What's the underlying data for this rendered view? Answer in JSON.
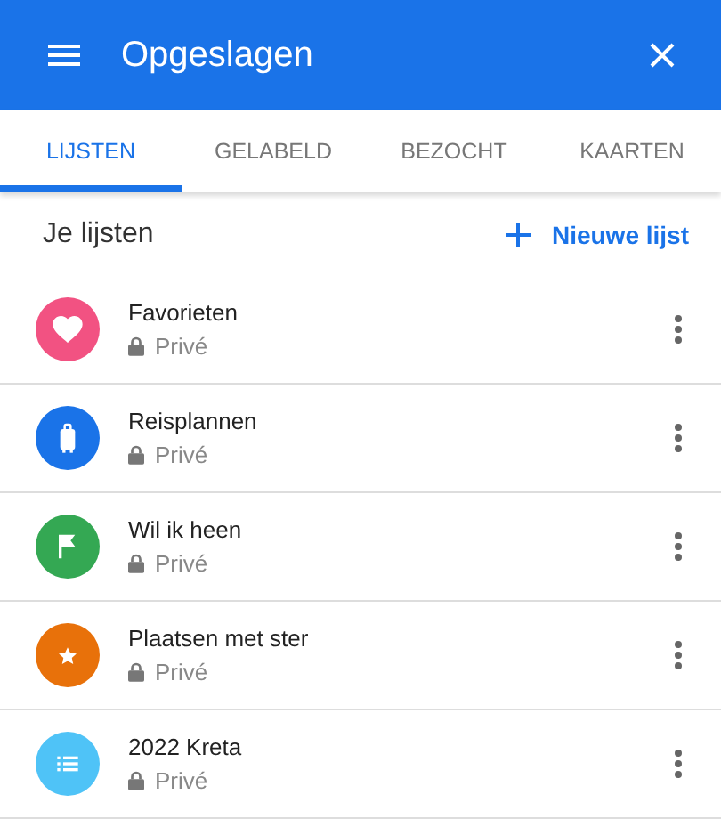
{
  "header": {
    "title": "Opgeslagen"
  },
  "tabs": [
    {
      "label": "LIJSTEN",
      "selected": true
    },
    {
      "label": "GELABELD",
      "selected": false
    },
    {
      "label": "BEZOCHT",
      "selected": false
    },
    {
      "label": "KAARTEN",
      "selected": false
    }
  ],
  "section": {
    "title": "Je lijsten",
    "new_list": "Nieuwe lijst"
  },
  "lists": [
    {
      "name": "Favorieten",
      "privacy": "Privé",
      "kind": "heart",
      "color": "#f25282"
    },
    {
      "name": "Reisplannen",
      "privacy": "Privé",
      "kind": "suitcase",
      "color": "#1a73e8"
    },
    {
      "name": "Wil ik heen",
      "privacy": "Privé",
      "kind": "flag",
      "color": "#34a853"
    },
    {
      "name": "Plaatsen met ster",
      "privacy": "Privé",
      "kind": "star",
      "color": "#e8710a"
    },
    {
      "name": "2022 Kreta",
      "privacy": "Privé",
      "kind": "list",
      "color": "#4fc3f7"
    }
  ]
}
